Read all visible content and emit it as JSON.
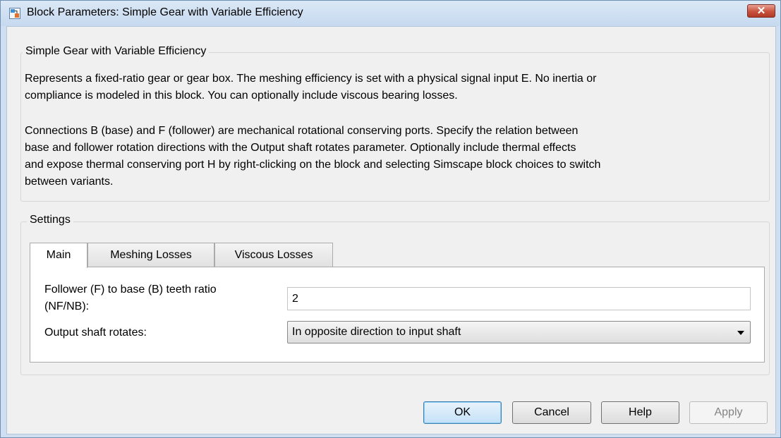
{
  "window": {
    "title": "Block Parameters: Simple Gear with Variable Efficiency",
    "close_label": "✕"
  },
  "description_group": {
    "title": "Simple Gear with Variable Efficiency",
    "paragraph1_line1": "Represents a fixed-ratio gear or gear box. The meshing efficiency is set with a physical signal input E. No inertia or",
    "paragraph1_line2": "compliance is modeled in this block. You can optionally include viscous bearing losses.",
    "paragraph2_line1": "Connections B (base) and F (follower) are mechanical rotational conserving ports. Specify the relation between",
    "paragraph2_line2": "base and follower rotation directions with the Output shaft rotates parameter. Optionally include thermal effects",
    "paragraph2_line3": "and expose thermal conserving port H by right-clicking on the block and selecting Simscape block choices to switch",
    "paragraph2_line4": "between variants."
  },
  "settings": {
    "title": "Settings",
    "tabs": [
      {
        "label": "Main",
        "active": true
      },
      {
        "label": "Meshing Losses",
        "active": false
      },
      {
        "label": "Viscous Losses",
        "active": false
      }
    ],
    "fields": {
      "teeth_ratio_label_line1": "Follower (F) to base (B) teeth ratio",
      "teeth_ratio_label_line2": "(NF/NB):",
      "teeth_ratio_value": "2",
      "output_shaft_label": "Output shaft rotates:",
      "output_shaft_value": "In opposite direction to input shaft"
    }
  },
  "buttons": {
    "ok": "OK",
    "cancel": "Cancel",
    "help": "Help",
    "apply": "Apply"
  },
  "colors": {
    "title_bar": "#c6d9ef",
    "close_button": "#c8513d",
    "dialog_background": "#f0f0f0"
  }
}
